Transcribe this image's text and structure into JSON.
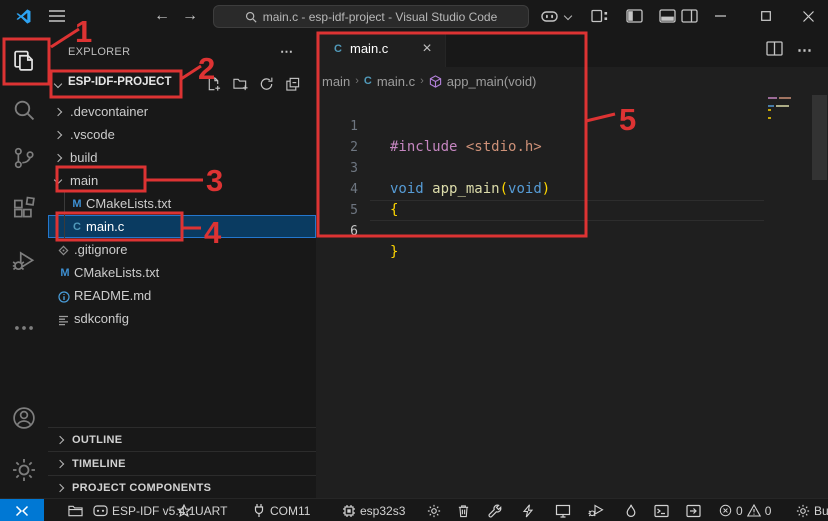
{
  "titlebar": {
    "search_value": "main.c - esp-idf-project - Visual Studio Code"
  },
  "explorer": {
    "title": "EXPLORER",
    "project": "ESP-IDF-PROJECT",
    "tree": [
      {
        "label": ".devcontainer"
      },
      {
        "label": ".vscode"
      },
      {
        "label": "build"
      },
      {
        "label": "main"
      },
      {
        "label": "CMakeLists.txt"
      },
      {
        "label": "main.c"
      },
      {
        "label": ".gitignore"
      },
      {
        "label": "CMakeLists.txt"
      },
      {
        "label": "README.md"
      },
      {
        "label": "sdkconfig"
      }
    ],
    "file_badges": {
      "cmake": "M",
      "c": "C"
    },
    "panels": [
      {
        "label": "OUTLINE"
      },
      {
        "label": "TIMELINE"
      },
      {
        "label": "PROJECT COMPONENTS"
      }
    ]
  },
  "editor": {
    "tab_label": "main.c",
    "tab_icon": "C",
    "breadcrumb": {
      "folder": "main",
      "file_icon": "C",
      "file": "main.c",
      "symbol": "app_main(void)"
    },
    "lines": [
      {
        "n": "1",
        "tokens": {
          "t0": "#include",
          "t1": " ",
          "t2": "<stdio.h>"
        }
      },
      {
        "n": "2"
      },
      {
        "n": "3",
        "tokens": {
          "t0": "void",
          "t1": " ",
          "t2": "app_main",
          "t3": "(",
          "t4": "void",
          "t5": ")"
        }
      },
      {
        "n": "4",
        "tokens": {
          "t0": "{"
        }
      },
      {
        "n": "5"
      },
      {
        "n": "6",
        "tokens": {
          "t0": "}"
        }
      }
    ]
  },
  "statusbar": {
    "espidf": "ESP-IDF v5.4.1",
    "flash_method": "UART",
    "port": "COM11",
    "target": "esp32s3",
    "errors": "0",
    "warnings": "0",
    "build_clipped": "Bu"
  },
  "annotations": {
    "n1": "1",
    "n2": "2",
    "n3": "3",
    "n4": "4",
    "n5": "5"
  },
  "colors": {
    "annotation_red": "#dd3333",
    "remote_blue": "#0078d4",
    "selection_bg": "#0a3b61",
    "selection_border": "#2477ce",
    "shell_bg": "#181818",
    "editor_bg": "#1f1f1f"
  }
}
